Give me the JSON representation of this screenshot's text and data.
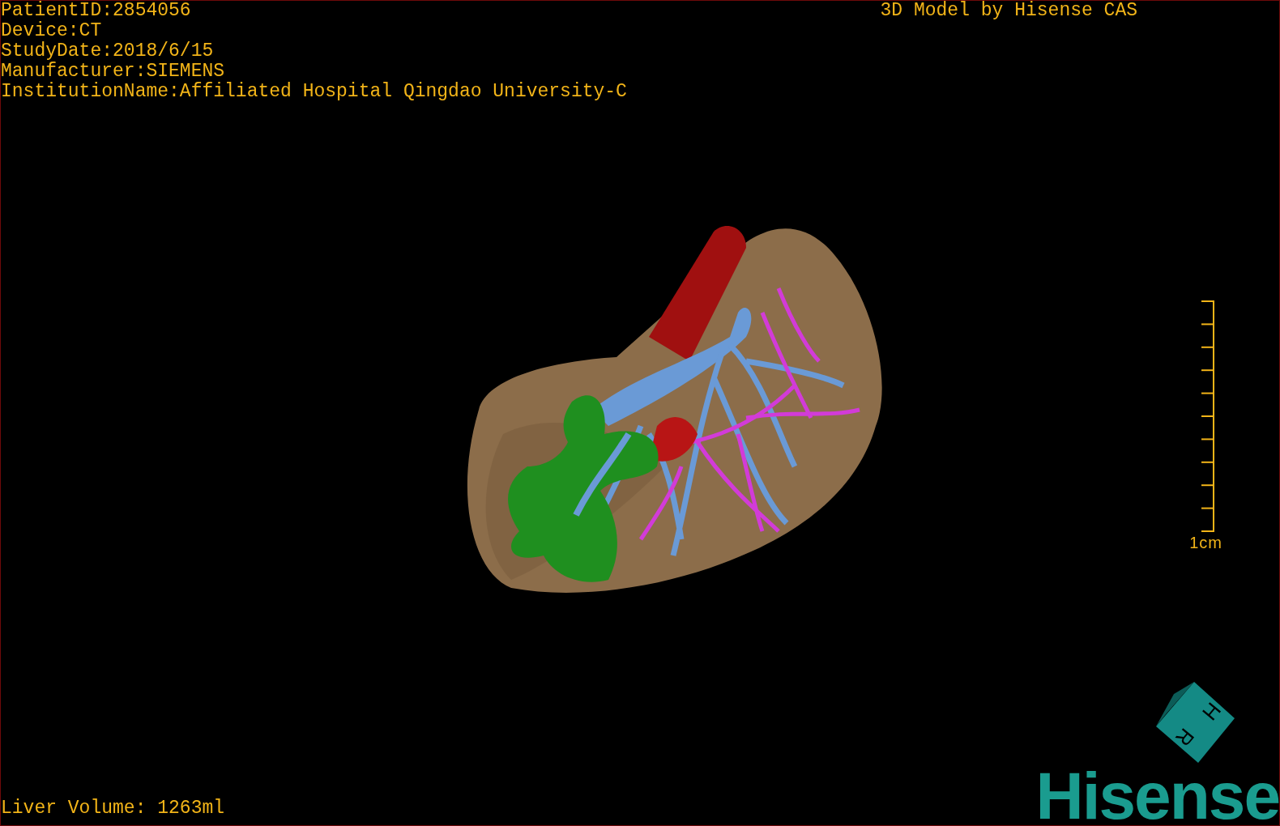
{
  "overlay": {
    "info_lines": [
      "PatientID:2854056",
      "Device:CT",
      "StudyDate:2018/6/15",
      "Manufacturer:SIEMENS",
      "InstitutionName:Affiliated Hospital Qingdao University-C"
    ],
    "model_caption": "3D Model by Hisense CAS"
  },
  "scale_bar": {
    "label": "1cm"
  },
  "liver_volume": "Liver Volume: 1263ml",
  "orientation_cube": {
    "labels": [
      "H",
      "R"
    ]
  },
  "logo": "Hisense"
}
